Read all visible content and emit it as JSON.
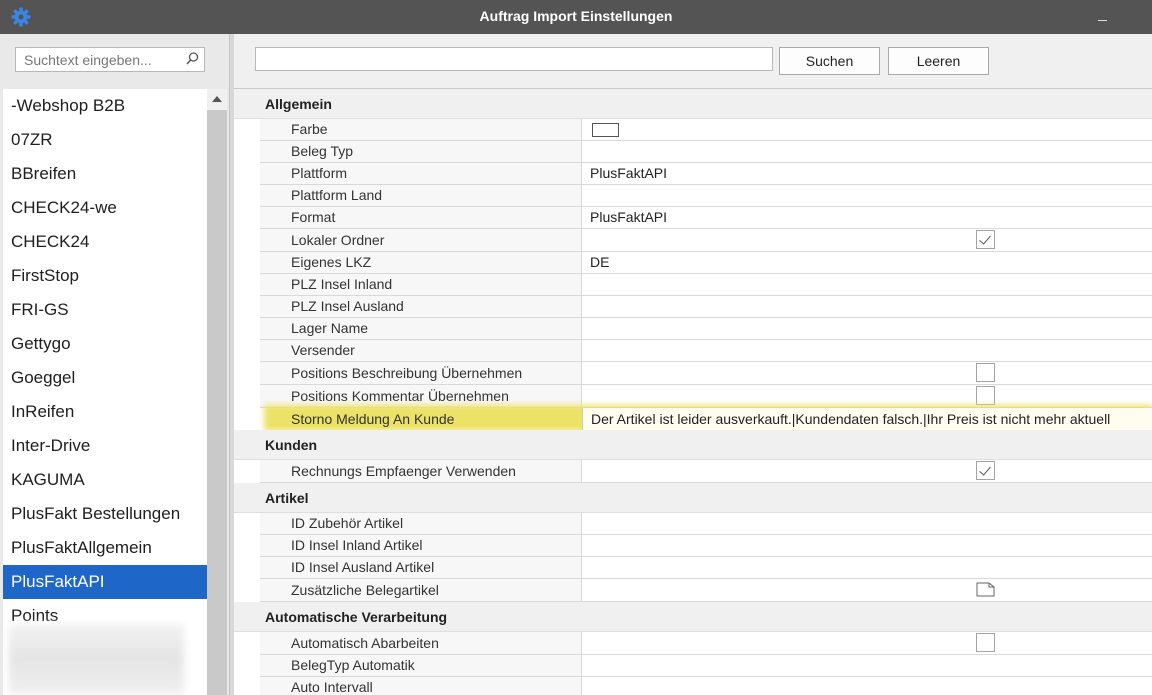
{
  "window": {
    "title": "Auftrag Import Einstellungen"
  },
  "left": {
    "search_placeholder": "Suchtext eingeben...",
    "items": [
      "-Webshop B2B",
      "07ZR",
      "BBreifen",
      "CHECK24-we",
      "CHECK24",
      "FirstStop",
      "FRI-GS",
      "Gettygo",
      "Goeggel",
      "InReifen",
      "Inter-Drive",
      "KAGUMA",
      "PlusFakt Bestellungen",
      "PlusFaktAllgemein",
      "PlusFaktAPI",
      "Points"
    ],
    "selected": "PlusFaktAPI"
  },
  "toolbar": {
    "search_label": "Suchen",
    "clear_label": "Leeren"
  },
  "sections": {
    "allgemein": {
      "title": "Allgemein",
      "rows": {
        "farbe": {
          "label": "Farbe"
        },
        "beleg_typ": {
          "label": "Beleg Typ",
          "value": ""
        },
        "plattform": {
          "label": "Plattform",
          "value": "PlusFaktAPI"
        },
        "plattform_land": {
          "label": "Plattform Land",
          "value": ""
        },
        "format": {
          "label": "Format",
          "value": "PlusFaktAPI"
        },
        "lokaler_ordner": {
          "label": "Lokaler Ordner",
          "checked": true
        },
        "eigenes_lkz": {
          "label": "Eigenes LKZ",
          "value": "DE"
        },
        "plz_insel_inland": {
          "label": "PLZ Insel Inland",
          "value": ""
        },
        "plz_insel_ausland": {
          "label": "PLZ Insel Ausland",
          "value": ""
        },
        "lager_name": {
          "label": "Lager Name",
          "value": ""
        },
        "versender": {
          "label": "Versender",
          "value": ""
        },
        "pos_beschreibung": {
          "label": "Positions Beschreibung Übernehmen",
          "checked": false
        },
        "pos_kommentar": {
          "label": "Positions Kommentar Übernehmen",
          "checked": false
        },
        "storno_meldung": {
          "label": "Storno Meldung An Kunde",
          "value": "Der Artikel ist leider ausverkauft.|Kundendaten falsch.|Ihr Preis ist nicht mehr aktuell"
        }
      }
    },
    "kunden": {
      "title": "Kunden",
      "rows": {
        "rechnungs_empfaenger": {
          "label": "Rechnungs Empfaenger Verwenden",
          "checked": true
        }
      }
    },
    "artikel": {
      "title": "Artikel",
      "rows": {
        "id_zubehoer": {
          "label": "ID Zubehör Artikel",
          "value": ""
        },
        "id_insel_inland": {
          "label": "ID Insel Inland Artikel",
          "value": ""
        },
        "id_insel_ausland": {
          "label": "ID Insel Ausland Artikel",
          "value": ""
        },
        "zusaetzliche_belegartikel": {
          "label": "Zusätzliche Belegartikel"
        }
      }
    },
    "automatik": {
      "title": "Automatische Verarbeitung",
      "rows": {
        "automatisch_abarbeiten": {
          "label": "Automatisch Abarbeiten",
          "checked": false
        },
        "belegtyp_automatik": {
          "label": "BelegTyp Automatik",
          "value": ""
        },
        "auto_intervall": {
          "label": "Auto Intervall",
          "value": ""
        }
      }
    }
  },
  "colors": {
    "titlebar": "#545454",
    "selection": "#1e66c8",
    "highlight": "#ece267"
  }
}
